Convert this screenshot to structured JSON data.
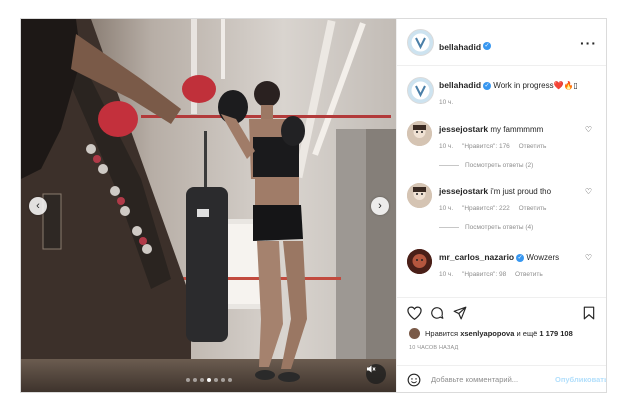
{
  "post": {
    "author": "bellahadid",
    "caption": {
      "username": "bellahadid",
      "text": "Work in progress",
      "emoji": "❤️🔥▯",
      "time": "10 ч."
    },
    "comments": [
      {
        "username": "jessejostark",
        "text": "my fammmmm",
        "time": "10 ч.",
        "likes": "\"Нравится\": 176",
        "reply": "Ответить",
        "view_replies": "Посмотреть ответы (2)"
      },
      {
        "username": "jessejostark",
        "text": "i'm just proud tho",
        "time": "10 ч.",
        "likes": "\"Нравится\": 222",
        "reply": "Ответить",
        "view_replies": "Посмотреть ответы (4)"
      },
      {
        "username": "mr_carlos_nazario",
        "text": "Wowzers",
        "time": "10 ч.",
        "likes": "\"Нравится\": 98",
        "reply": "Ответить"
      }
    ],
    "likes_line": {
      "prefix": "Нравится",
      "user": "xsenlyapopova",
      "suffix": "и ещё",
      "count": "1 179 108"
    },
    "posted_ago": "10 ЧАСОВ НАЗАД",
    "add_comment": {
      "placeholder": "Добавьте комментарий...",
      "publish": "Опубликовать"
    },
    "carousel": {
      "slides": 7,
      "active": 3
    }
  },
  "colors": {
    "verified": "#3897f0",
    "publish_disabled": "#b2dffc",
    "meta": "#8e8e8e"
  },
  "icons": [
    "more-options-icon",
    "verified-icon",
    "heart-icon",
    "comment-icon",
    "share-icon",
    "bookmark-icon",
    "emoji-icon",
    "mute-icon",
    "chevron-left-icon",
    "chevron-right-icon"
  ]
}
